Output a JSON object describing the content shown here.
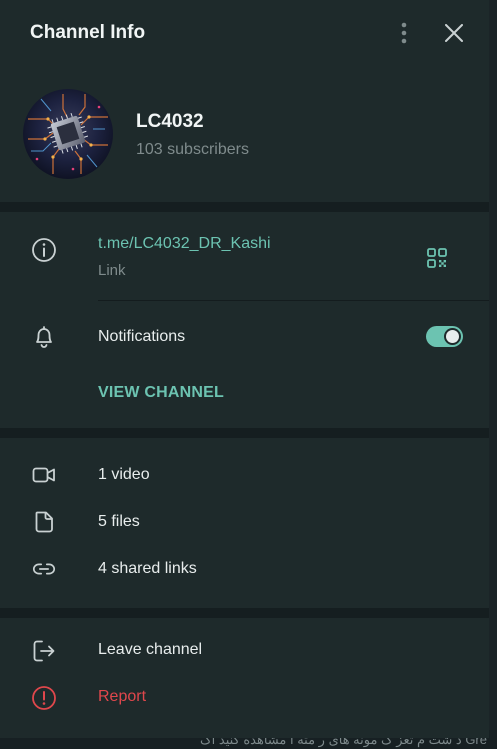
{
  "header": {
    "title": "Channel Info"
  },
  "channel": {
    "name": "LC4032",
    "subscribers": "103 subscribers"
  },
  "info": {
    "link": "t.me/LC4032_DR_Kashi",
    "link_caption": "Link",
    "notifications_label": "Notifications",
    "notifications_on": true,
    "view_channel_label": "VIEW CHANNEL"
  },
  "media": {
    "video": "1 video",
    "files": "5 files",
    "shared_links": "4 shared links"
  },
  "actions": {
    "leave": "Leave channel",
    "report": "Report"
  },
  "background": {
    "bottom_text": "د شت م تعز گ مونه های ر مثه ا مشاهده کنید اگ Gre"
  },
  "colors": {
    "panel": "#1e2a2b",
    "accent": "#6cc3b1",
    "danger": "#e0474c",
    "separator": "#151e20"
  },
  "icons": [
    "more-vertical-icon",
    "close-icon",
    "info-icon",
    "qr-code-icon",
    "bell-icon",
    "video-icon",
    "file-icon",
    "link-icon",
    "logout-icon",
    "alert-circle-icon"
  ]
}
